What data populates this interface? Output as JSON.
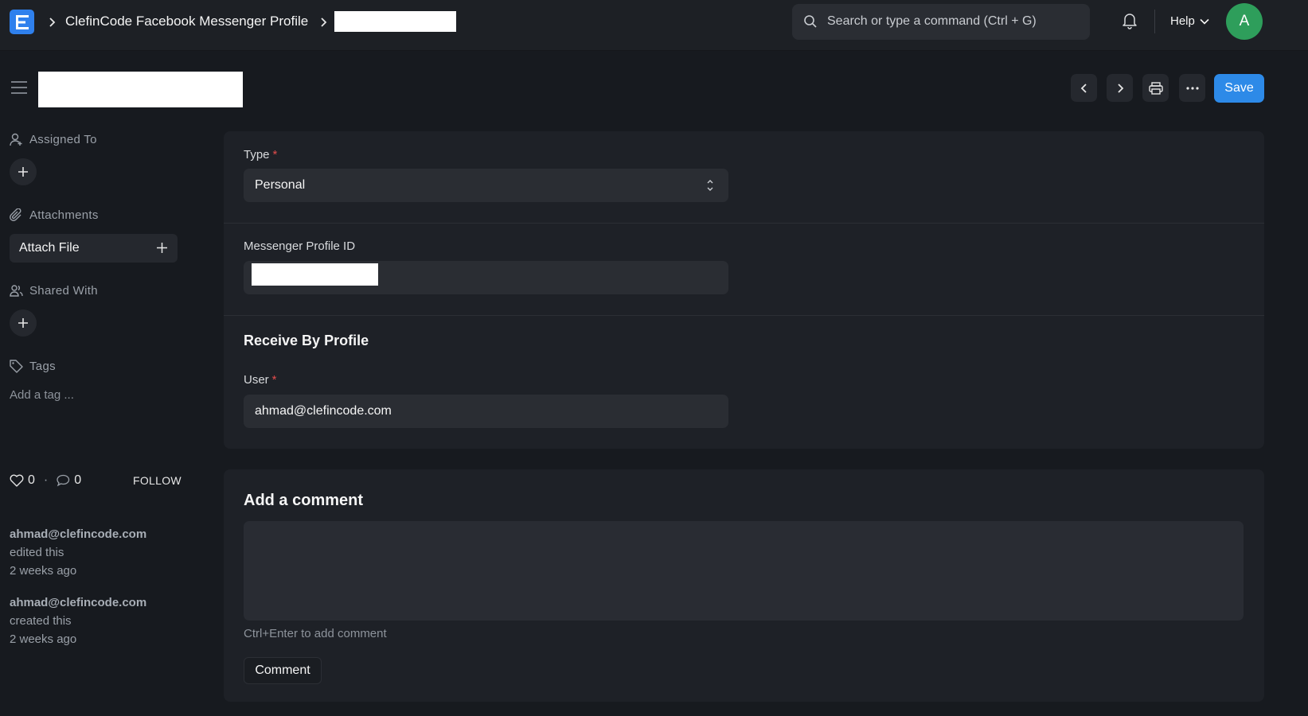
{
  "navbar": {
    "breadcrumb": "ClefinCode Facebook Messenger Profile",
    "search_placeholder": "Search or type a command (Ctrl + G)",
    "help": "Help",
    "avatar_initial": "A"
  },
  "header": {
    "save": "Save"
  },
  "sidebar": {
    "assigned_to": "Assigned To",
    "attachments": "Attachments",
    "attach_file": "Attach File",
    "shared_with": "Shared With",
    "tags": "Tags",
    "add_tag": "Add a tag ...",
    "likes": "0",
    "comments": "0",
    "follow": "FOLLOW",
    "timeline": [
      {
        "user": "ahmad@clefincode.com",
        "action": "edited this",
        "time": "2 weeks ago"
      },
      {
        "user": "ahmad@clefincode.com",
        "action": "created this",
        "time": "2 weeks ago"
      }
    ]
  },
  "form": {
    "type_label": "Type",
    "type_value": "Personal",
    "profile_id_label": "Messenger Profile ID",
    "section_title": "Receive By Profile",
    "user_label": "User",
    "user_value": "ahmad@clefincode.com"
  },
  "comments": {
    "title": "Add a comment",
    "hint": "Ctrl+Enter to add comment",
    "button": "Comment"
  }
}
